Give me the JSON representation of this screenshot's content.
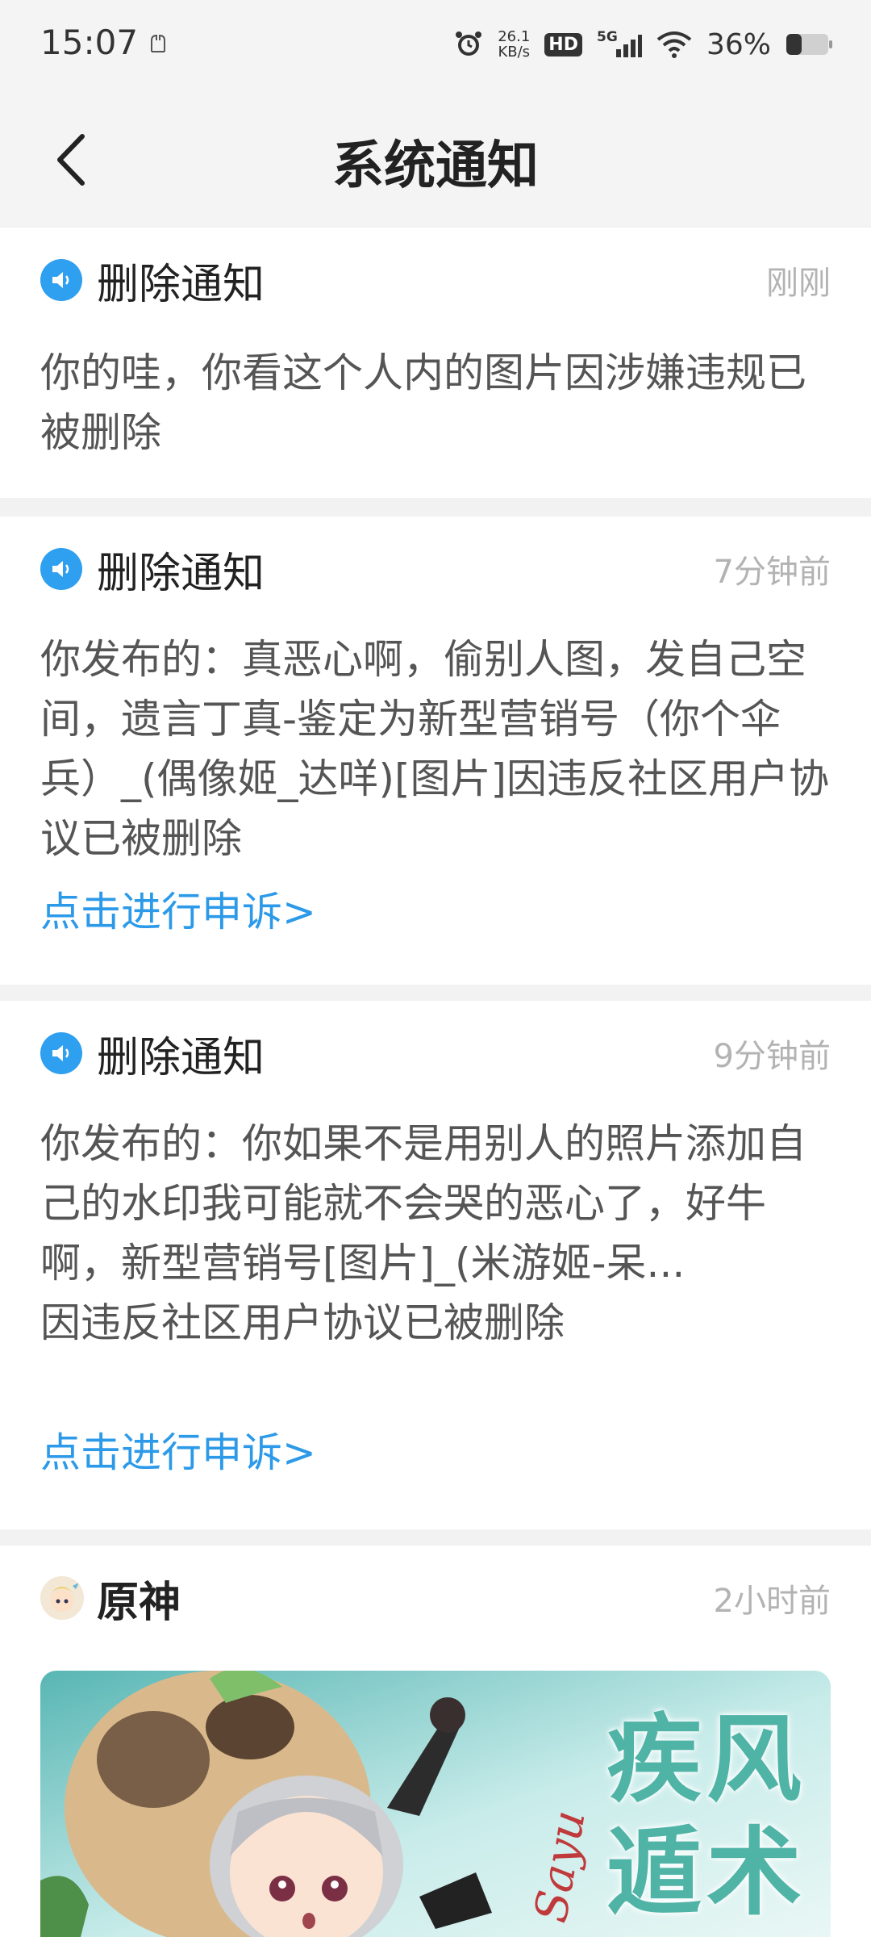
{
  "status_bar": {
    "time": "15:07",
    "net_speed_value": "26.1",
    "net_speed_unit": "KB/s",
    "hd": "HD",
    "network": "5G",
    "battery": "36%"
  },
  "header": {
    "title": "系统通知"
  },
  "notifications": [
    {
      "title": "删除通知",
      "time": "刚刚",
      "body": "你的哇，你看这个人内的图片因涉嫌违规已被删除"
    },
    {
      "title": "删除通知",
      "time": "7分钟前",
      "body": "你发布的：真恶心啊，偷别人图，发自己空间，遗言丁真-鉴定为新型营销号（你个伞兵）_(偶像姬_达咩)[图片]因违反社区用户协议已被删除",
      "appeal": "点击进行申诉>"
    },
    {
      "title": "删除通知",
      "time": "9分钟前",
      "body": "你发布的：你如果不是用别人的照片添加自己的水印我可能就不会哭的恶心了，好牛啊，新型营销号[图片]_(米游姬-呆...",
      "body_line2": "因违反社区用户协议已被删除",
      "appeal": "点击进行申诉>"
    },
    {
      "title": "原神",
      "time": "2小时前",
      "banner_text_line1": "疾风",
      "banner_text_line2": "遁术",
      "banner_script": "Sayu"
    }
  ]
}
